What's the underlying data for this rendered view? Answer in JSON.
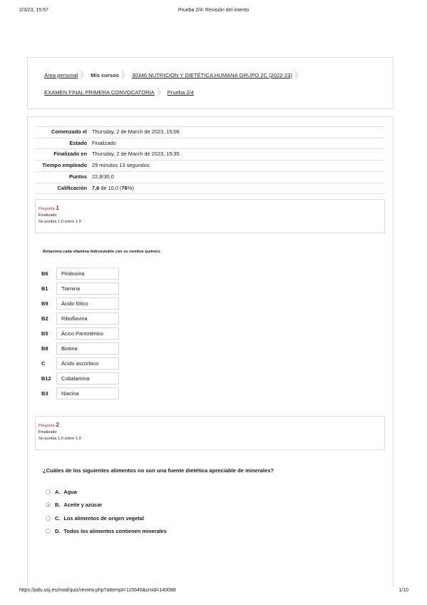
{
  "print": {
    "datetime": "2/3/23, 15:57",
    "title": "Prueba 2/4: Revisión del intento",
    "url": "https://pdu.usj.es/mod/quiz/review.php?attempt=115646&cmid=140088",
    "page": "1/10"
  },
  "breadcrumb": {
    "items": [
      "Área personal",
      "Mis cursos",
      "30346 NUTRICIÓN Y DIETÉTICA HUMANA GRUPO 2C (2022-23)",
      "EXAMEN FINAL PRIMERA CONVOCATORIA",
      "Prueba 2/4"
    ]
  },
  "summary": {
    "rows": [
      {
        "label": "Comenzado el",
        "value": "Thursday, 2 de March de 2023, 15:06"
      },
      {
        "label": "Estado",
        "value": "Finalizado"
      },
      {
        "label": "Finalizado en",
        "value": "Thursday, 2 de March de 2023, 15:35"
      },
      {
        "label": "Tiempo empleado",
        "value": "29 minutos 13 segundos"
      },
      {
        "label": "Puntos",
        "value": "22,8/30,0"
      }
    ],
    "grade_label": "Calificación",
    "grade_value": "7,6",
    "grade_rest": " de 10,0 (",
    "grade_percent": "76",
    "grade_end": "%)"
  },
  "questions": [
    {
      "prefix": "Pregunta",
      "number": "1",
      "state": "Finalizado",
      "score": "Se puntúa 1,0 sobre 1,0",
      "text": "Relaciona cada vitamina hidrosoluble con su nombre químico",
      "pairs": [
        {
          "label": "B6",
          "answer": "Piridoxina"
        },
        {
          "label": "B1",
          "answer": "Tiamina"
        },
        {
          "label": "B9",
          "answer": "Ácido fólico"
        },
        {
          "label": "B2",
          "answer": "Riboflavina"
        },
        {
          "label": "B5",
          "answer": "Ácico Pantoténico"
        },
        {
          "label": "B8",
          "answer": "Biotina"
        },
        {
          "label": "C",
          "answer": "Ácido ascórbico"
        },
        {
          "label": "B12",
          "answer": "Cobalamina"
        },
        {
          "label": "B3",
          "answer": "Niacina"
        }
      ]
    },
    {
      "prefix": "Pregunta",
      "number": "2",
      "state": "Finalizado",
      "score": "Se puntúa 1,0 sobre 1,0",
      "text": "¿Cuáles de los siguientes alimentos no son una fuente dietética apreciable de minerales?",
      "options": [
        {
          "letter": "A.",
          "text": "Agua",
          "selected": false
        },
        {
          "letter": "B.",
          "text": "Aceite y azúcar",
          "selected": true
        },
        {
          "letter": "C.",
          "text": "Los alimentos de origen vegetal",
          "selected": false
        },
        {
          "letter": "D.",
          "text": "Todos los alimentos contienen minerales",
          "selected": false
        }
      ]
    }
  ],
  "colors": {
    "accent": "#c0262e",
    "border": "#dddddd"
  }
}
